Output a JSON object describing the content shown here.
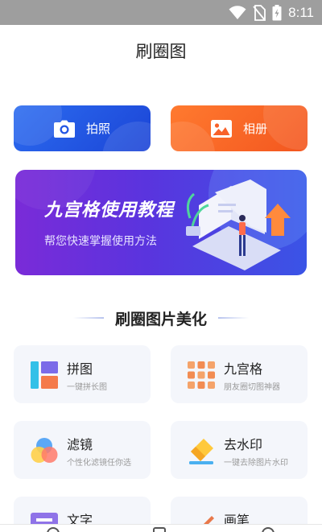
{
  "status_bar": {
    "time": "8:11",
    "icons": [
      "wifi-icon",
      "no-sim-icon",
      "battery-charging-icon"
    ]
  },
  "page": {
    "title": "刷圈图"
  },
  "actions": {
    "camera": {
      "label": "拍照",
      "icon": "camera-icon",
      "color": "#2356e4"
    },
    "album": {
      "label": "相册",
      "icon": "image-icon",
      "color": "#f8622a"
    }
  },
  "banner": {
    "title": "九宫格使用教程",
    "subtitle": "帮您快速掌握使用方法"
  },
  "section": {
    "title": "刷圈图片美化"
  },
  "tools": [
    {
      "title": "拼图",
      "subtitle": "一键拼长图",
      "icon": "collage-icon"
    },
    {
      "title": "九宫格",
      "subtitle": "朋友圈切图神器",
      "icon": "nine-grid-icon"
    },
    {
      "title": "滤镜",
      "subtitle": "个性化滤镜任你选",
      "icon": "filter-icon"
    },
    {
      "title": "去水印",
      "subtitle": "一键去除图片水印",
      "icon": "eraser-icon"
    },
    {
      "title": "文字",
      "subtitle": "",
      "icon": "text-icon"
    },
    {
      "title": "画笔",
      "subtitle": "",
      "icon": "brush-icon"
    }
  ]
}
